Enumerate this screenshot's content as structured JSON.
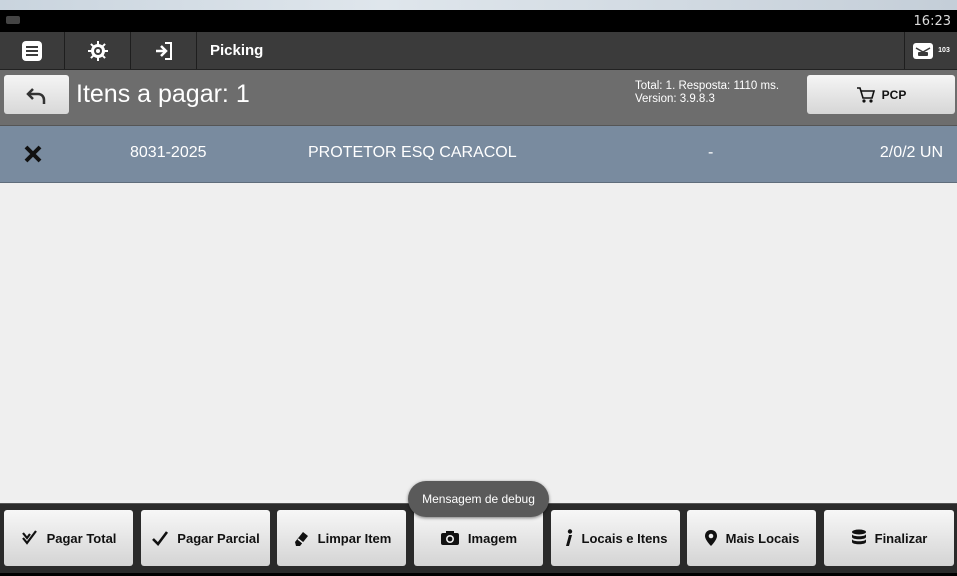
{
  "status_bar": {
    "time": "16:23"
  },
  "toolbar": {
    "title": "Picking",
    "message_count": "103"
  },
  "header": {
    "title": "Itens a pagar: 1",
    "info_line1": "Total: 1. Resposta: 1110 ms.",
    "info_line2": "Version: 3.9.8.3",
    "pcp_label": "PCP"
  },
  "items": [
    {
      "code": "8031-2025",
      "description": "PROTETOR ESQ CARACOL",
      "location": "-",
      "quantity": "2/0/2 UN"
    }
  ],
  "toast": "Mensagem de debug",
  "actions": {
    "pagar_total": "Pagar Total",
    "pagar_parcial": "Pagar Parcial",
    "limpar_item": "Limpar Item",
    "imagem": "Imagem",
    "locais_itens": "Locais e Itens",
    "mais_locais": "Mais Locais",
    "finalizar": "Finalizar"
  },
  "colors": {
    "toolbar": "#3b3b3b",
    "header": "#6d6d6d",
    "row": "#798b9f",
    "background": "#efefef"
  }
}
